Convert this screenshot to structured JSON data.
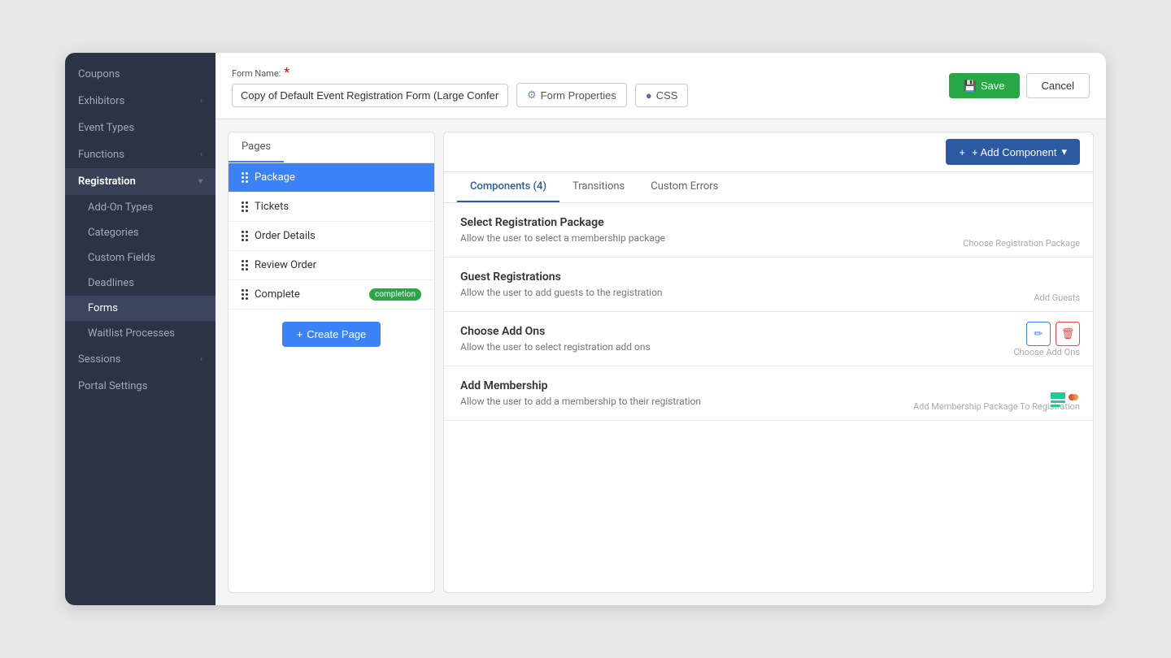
{
  "sidebar": {
    "items": [
      {
        "label": "Coupons",
        "hasChevron": false,
        "active": false
      },
      {
        "label": "Exhibitors",
        "hasChevron": true,
        "active": false
      },
      {
        "label": "Event Types",
        "hasChevron": false,
        "active": false
      },
      {
        "label": "Functions",
        "hasChevron": true,
        "active": false
      },
      {
        "label": "Registration",
        "hasChevron": true,
        "active": true,
        "isSection": true
      },
      {
        "label": "Add-On Types",
        "isSub": true,
        "active": false
      },
      {
        "label": "Categories",
        "isSub": true,
        "active": false
      },
      {
        "label": "Custom Fields",
        "isSub": true,
        "active": false
      },
      {
        "label": "Deadlines",
        "isSub": true,
        "active": false
      },
      {
        "label": "Forms",
        "isSub": true,
        "active": true
      },
      {
        "label": "Waitlist Processes",
        "isSub": true,
        "active": false
      },
      {
        "label": "Sessions",
        "hasChevron": true,
        "active": false
      },
      {
        "label": "Portal Settings",
        "active": false
      }
    ]
  },
  "header": {
    "form_name_label": "Form Name:",
    "required_indicator": "*",
    "form_name_value": "Copy of Default Event Registration Form (Large Conference)",
    "btn_form_properties": "Form Properties",
    "btn_css": "CSS",
    "btn_save": "Save",
    "btn_cancel": "Cancel"
  },
  "pages_panel": {
    "header_label": "Pages",
    "pages": [
      {
        "label": "Package",
        "active": true
      },
      {
        "label": "Tickets",
        "active": false
      },
      {
        "label": "Order Details",
        "active": false
      },
      {
        "label": "Review Order",
        "active": false
      },
      {
        "label": "Complete",
        "badge": "completion",
        "active": false
      }
    ],
    "create_page_btn": "+ Create Page"
  },
  "components_panel": {
    "btn_add_component": "+ Add Component",
    "tabs": [
      {
        "label": "Components (4)",
        "active": true
      },
      {
        "label": "Transitions",
        "active": false
      },
      {
        "label": "Custom Errors",
        "active": false
      }
    ],
    "components": [
      {
        "id": "comp1",
        "title": "Select Registration Package",
        "description": "Allow the user to select a membership package",
        "type_label": "Choose Registration Package",
        "has_actions": false
      },
      {
        "id": "comp2",
        "title": "Guest Registrations",
        "description": "Allow the user to add guests to the registration",
        "type_label": "Add Guests",
        "has_actions": false
      },
      {
        "id": "comp3",
        "title": "Choose Add Ons",
        "description": "Allow the user to select registration add ons",
        "type_label": "Choose Add Ons",
        "has_actions": true
      },
      {
        "id": "comp4",
        "title": "Add Membership",
        "description": "Allow the user to add a membership to their registration",
        "type_label": "Add Membership Package To Registration",
        "has_actions": false
      }
    ]
  },
  "icons": {
    "gear": "⚙",
    "css_icon": "●",
    "save_icon": "💾",
    "plus": "+",
    "chevron_down": "▾",
    "chevron_right": "›",
    "edit_pencil": "✏",
    "delete_trash": "🗑"
  }
}
